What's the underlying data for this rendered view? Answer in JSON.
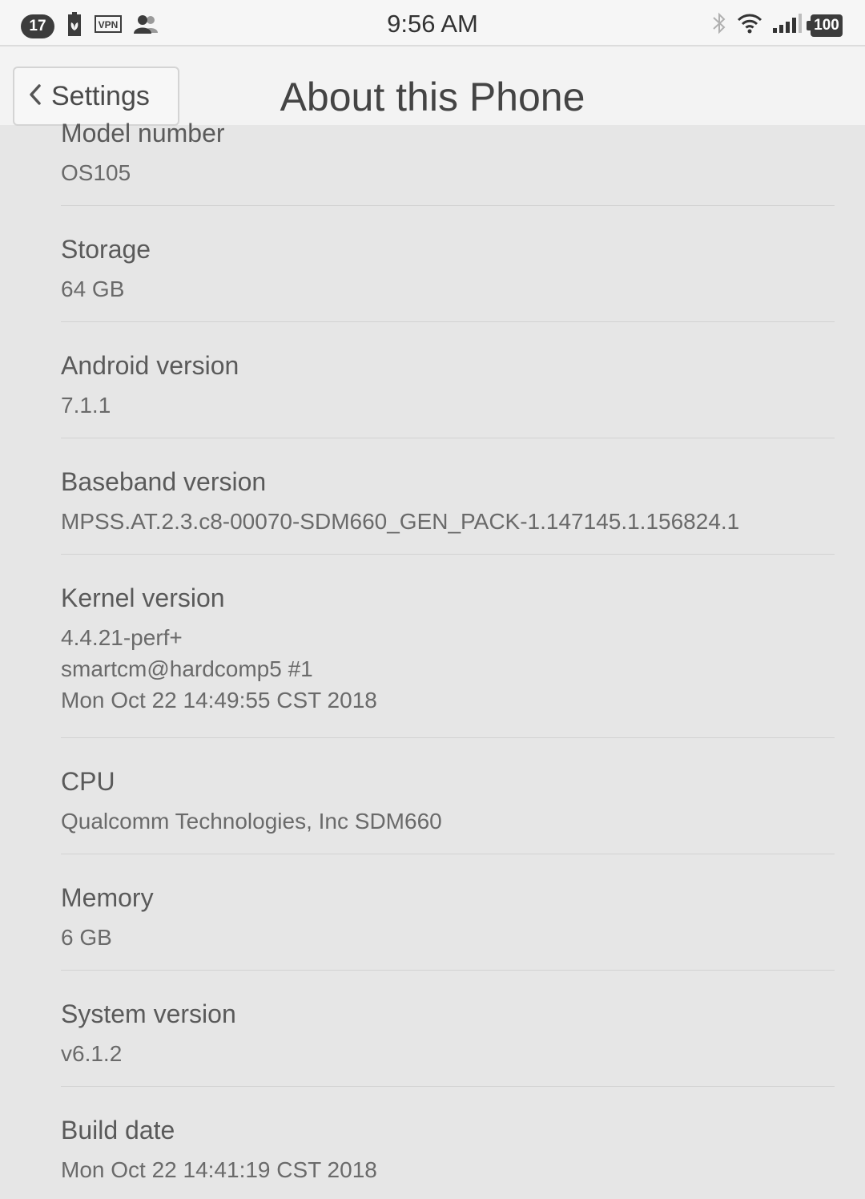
{
  "status_bar": {
    "notification_count": "17",
    "vpn_label": "VPN",
    "time": "9:56 AM",
    "battery": "100"
  },
  "header": {
    "back_label": "Settings",
    "title": "About this Phone"
  },
  "items": [
    {
      "label": "Model number",
      "value": "OS105"
    },
    {
      "label": "Storage",
      "value": "64 GB"
    },
    {
      "label": "Android version",
      "value": "7.1.1"
    },
    {
      "label": "Baseband version",
      "value": "MPSS.AT.2.3.c8-00070-SDM660_GEN_PACK-1.147145.1.156824.1"
    },
    {
      "label": "Kernel version",
      "value_lines": [
        "4.4.21-perf+",
        "smartcm@hardcomp5 #1",
        "Mon Oct 22 14:49:55 CST 2018"
      ]
    },
    {
      "label": "CPU",
      "value": "Qualcomm Technologies, Inc SDM660"
    },
    {
      "label": "Memory",
      "value": "6 GB"
    },
    {
      "label": "System version",
      "value": "v6.1.2"
    },
    {
      "label": "Build date",
      "value": "Mon Oct 22 14:41:19 CST 2018"
    }
  ],
  "icons": [
    "security-icon",
    "vpn-icon",
    "contacts-icon",
    "bluetooth-icon",
    "wifi-icon",
    "signal-icon",
    "battery-icon",
    "chevron-left-icon"
  ]
}
